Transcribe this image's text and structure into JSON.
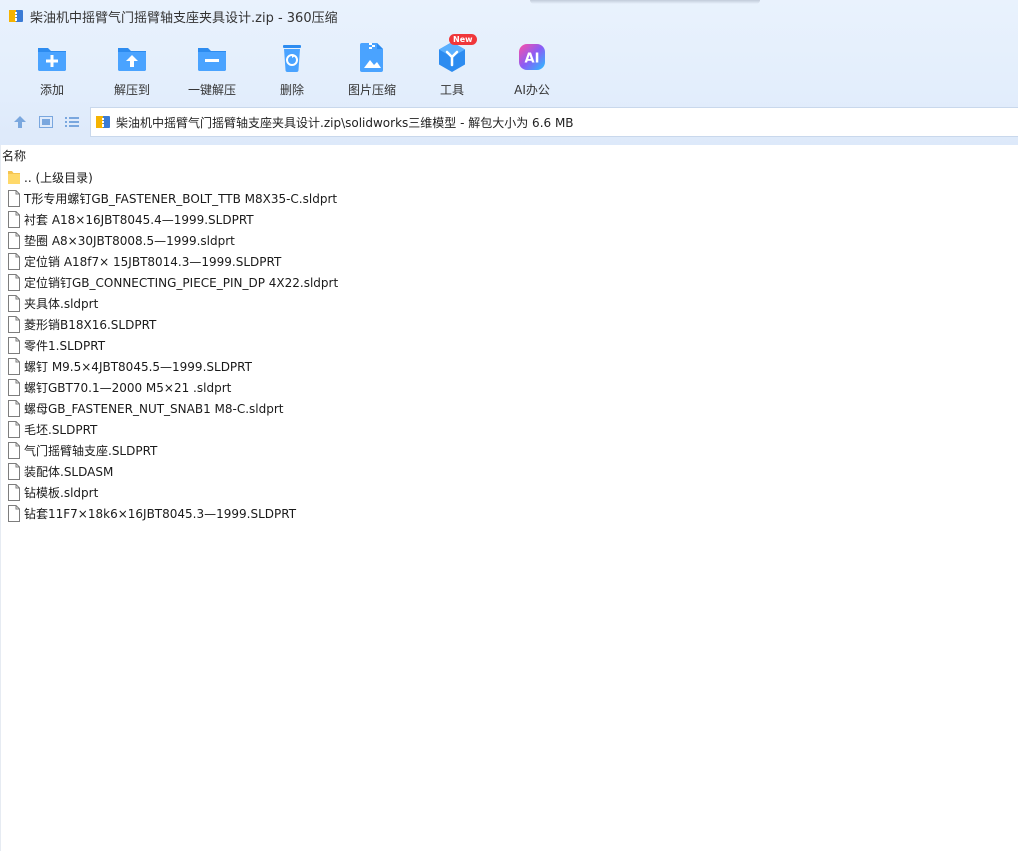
{
  "window": {
    "title": "柴油机中摇臂气门摇臂轴支座夹具设计.zip - 360压缩"
  },
  "toolbar": {
    "items": [
      {
        "label": "添加",
        "icon": "add-icon",
        "color": "#2d8cf0"
      },
      {
        "label": "解压到",
        "icon": "extract-to-icon",
        "color": "#2d8cf0"
      },
      {
        "label": "一键解压",
        "icon": "one-click-extract-icon",
        "color": "#2d8cf0"
      },
      {
        "label": "删除",
        "icon": "delete-icon",
        "color": "#2d8cf0"
      },
      {
        "label": "图片压缩",
        "icon": "image-compress-icon",
        "color": "#2d8cf0"
      },
      {
        "label": "工具",
        "icon": "tools-icon",
        "color": "#2d8cf0",
        "badge": "New"
      },
      {
        "label": "AI办公",
        "icon": "ai-office-icon",
        "color": "#8a5cf6"
      }
    ]
  },
  "address": {
    "path": "柴油机中摇臂气门摇臂轴支座夹具设计.zip\\solidworks三维模型 - 解包大小为 6.6 MB"
  },
  "list": {
    "column_name": "名称",
    "items": [
      {
        "name": ".. (上级目录)",
        "type": "folder"
      },
      {
        "name": "T形专用螺钉GB_FASTENER_BOLT_TTB M8X35-C.sldprt",
        "type": "file"
      },
      {
        "name": "衬套 A18×16JBT8045.4—1999.SLDPRT",
        "type": "file"
      },
      {
        "name": "垫圈 A8×30JBT8008.5—1999.sldprt",
        "type": "file"
      },
      {
        "name": "定位销 A18f7× 15JBT8014.3—1999.SLDPRT",
        "type": "file"
      },
      {
        "name": "定位销钉GB_CONNECTING_PIECE_PIN_DP 4X22.sldprt",
        "type": "file"
      },
      {
        "name": "夹具体.sldprt",
        "type": "file"
      },
      {
        "name": "菱形销B18X16.SLDPRT",
        "type": "file"
      },
      {
        "name": "零件1.SLDPRT",
        "type": "file"
      },
      {
        "name": "螺钉 M9.5×4JBT8045.5—1999.SLDPRT",
        "type": "file"
      },
      {
        "name": "螺钉GBT70.1—2000 M5×21 .sldprt",
        "type": "file"
      },
      {
        "name": "螺母GB_FASTENER_NUT_SNAB1 M8-C.sldprt",
        "type": "file"
      },
      {
        "name": "毛坯.SLDPRT",
        "type": "file"
      },
      {
        "name": "气门摇臂轴支座.SLDPRT",
        "type": "file"
      },
      {
        "name": "装配体.SLDASM",
        "type": "file"
      },
      {
        "name": "钻模板.sldprt",
        "type": "file"
      },
      {
        "name": "钻套11F7×18k6×16JBT8045.3—1999.SLDPRT",
        "type": "file"
      }
    ]
  }
}
